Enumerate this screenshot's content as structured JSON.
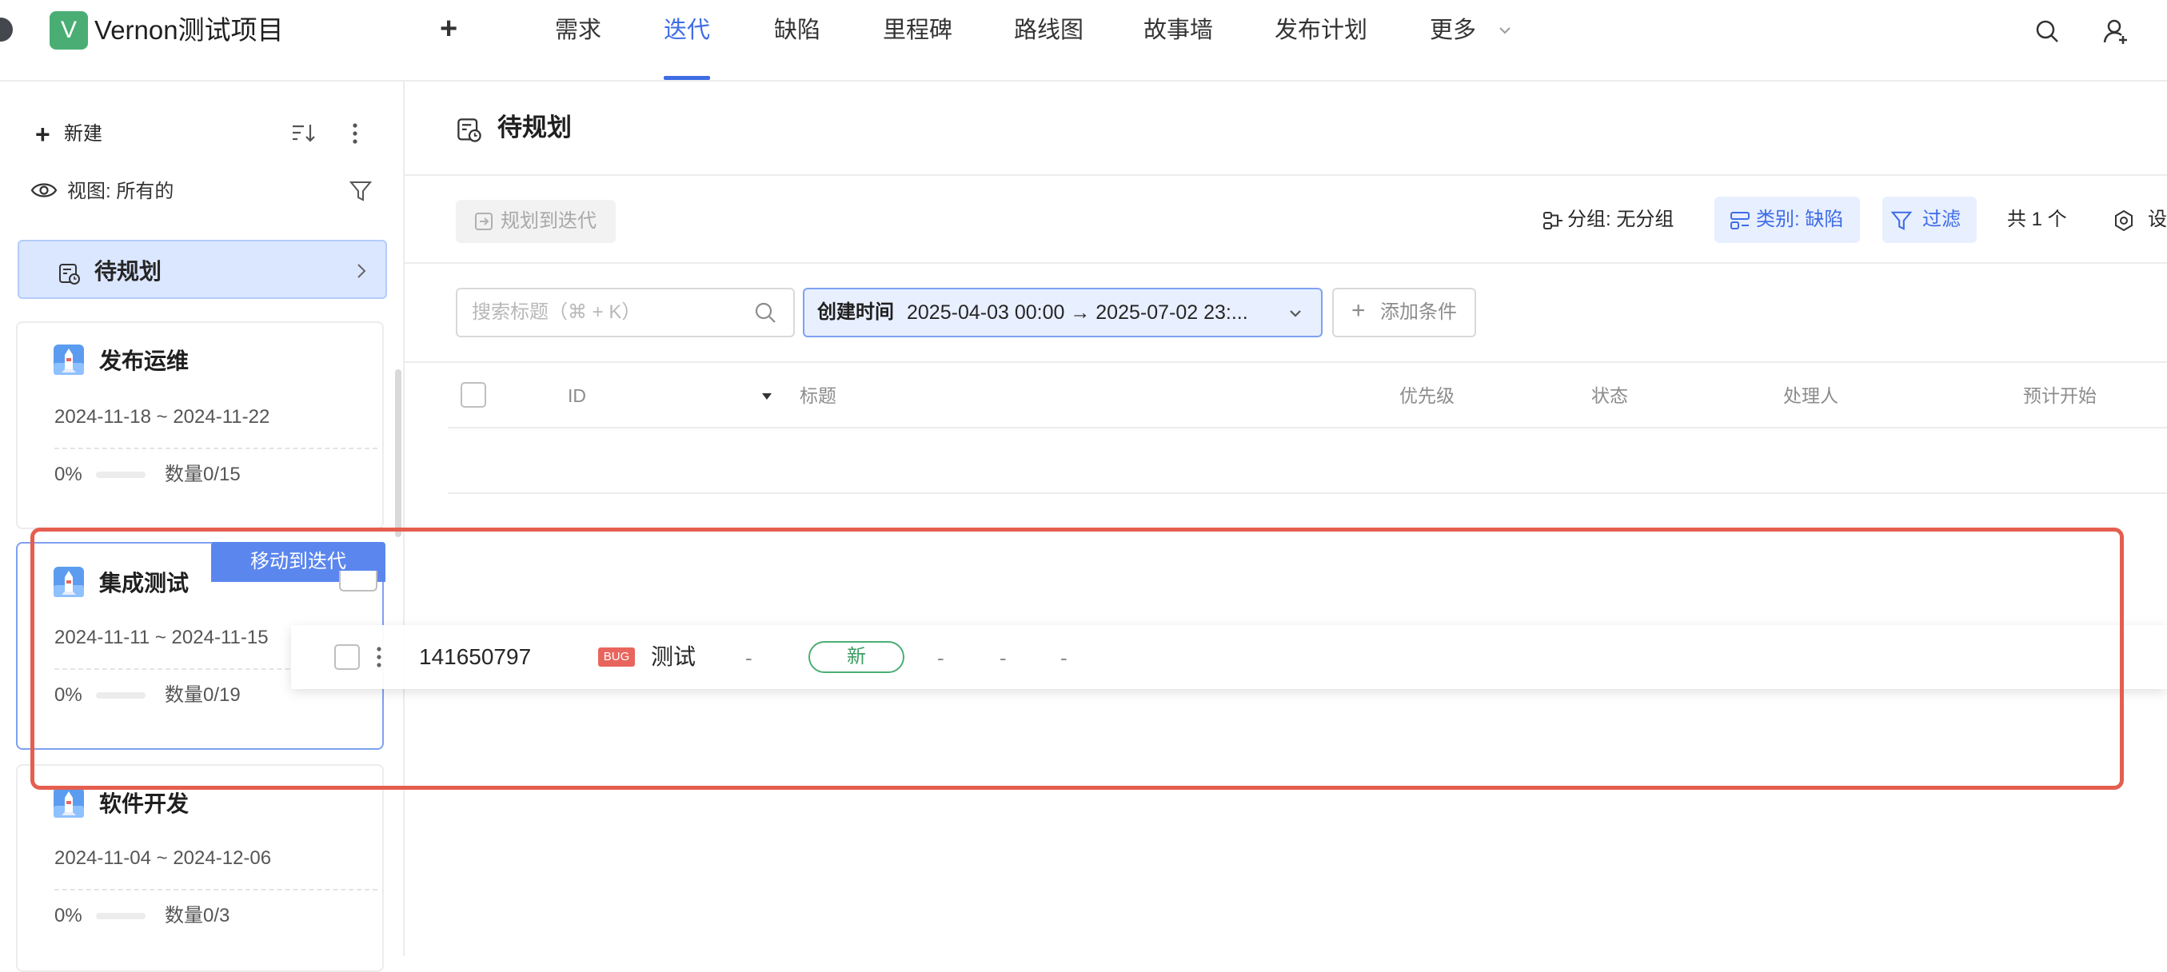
{
  "project": {
    "logo_letter": "V",
    "name": "Vernon测试项目"
  },
  "nav": {
    "add": "+",
    "items": [
      "需求",
      "迭代",
      "缺陷",
      "里程碑",
      "路线图",
      "故事墙",
      "发布计划",
      "更多"
    ],
    "active": "迭代"
  },
  "sidebar": {
    "new_label": "新建",
    "view_label": "视图:  所有的",
    "backlog_label": "待规划",
    "iterations": [
      {
        "title": "发布运维",
        "dates": "2024-11-18 ~ 2024-11-22",
        "progress": "0%",
        "progress_value": 0,
        "count": "数量0/15"
      },
      {
        "title": "集成测试",
        "dates": "2024-11-11 ~ 2024-11-15",
        "progress": "0%",
        "progress_value": 0,
        "count": "数量0/19"
      },
      {
        "title": "软件开发",
        "dates": "2024-11-04 ~ 2024-12-06",
        "progress": "0%",
        "progress_value": 0,
        "count": "数量0/3"
      }
    ],
    "move_tag": "移动到迭代"
  },
  "main": {
    "title": "待规划",
    "toolbar": {
      "plan_button": "规划到迭代",
      "group_label": "分组:  无分组",
      "type_label": "类别: 缺陷",
      "filter_label": "过滤",
      "total_label": "共 1 个",
      "settings_label": "设"
    },
    "search": {
      "placeholder": "搜索标题（⌘ + K）",
      "value": ""
    },
    "date_filter": {
      "key": "创建时间",
      "value": "2025-04-03 00:00 → 2025-07-02 23:..."
    },
    "add_condition": "添加条件",
    "columns": [
      "ID",
      "标题",
      "优先级",
      "状态",
      "处理人",
      "预计开始"
    ]
  },
  "drag_row": {
    "id": "141650797",
    "badge": "BUG",
    "title": "测试",
    "priority": "-",
    "status": "新",
    "assignee": "-",
    "start": "-",
    "end": "-"
  },
  "colors": {
    "accent": "#3e6ce6",
    "highlight": "#e55e4f",
    "status_green": "#4aae74",
    "bug_red": "#e8655d"
  }
}
